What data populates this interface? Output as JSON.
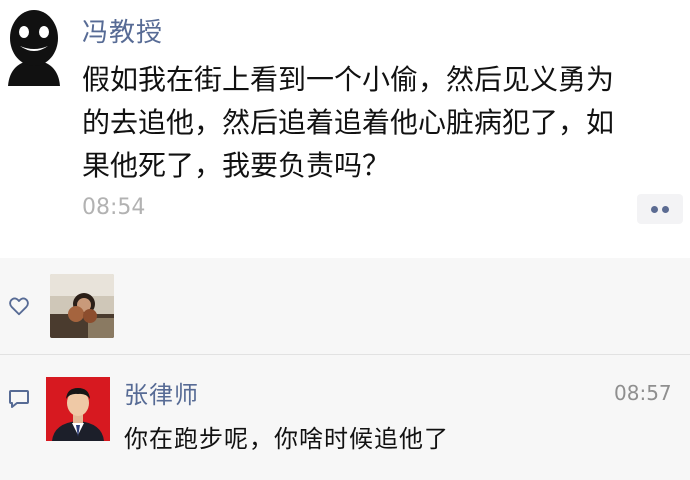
{
  "post": {
    "author": "冯教授",
    "content": "假如我在街上看到一个小偷，然后见义勇为\n的去追他，然后追着追着他心脏病犯了，如\n果他死了，我要负责吗？",
    "time": "08:54"
  },
  "comment": {
    "author": "张律师",
    "time": "08:57",
    "text": "你在跑步呢，你啥时候追他了"
  },
  "icons": {
    "like": "heart-icon",
    "comment": "comment-icon",
    "more": "more-icon"
  },
  "colors": {
    "name_link": "#576b95",
    "timestamp": "#b2b2b2",
    "interaction_bg": "#f7f7f7"
  }
}
